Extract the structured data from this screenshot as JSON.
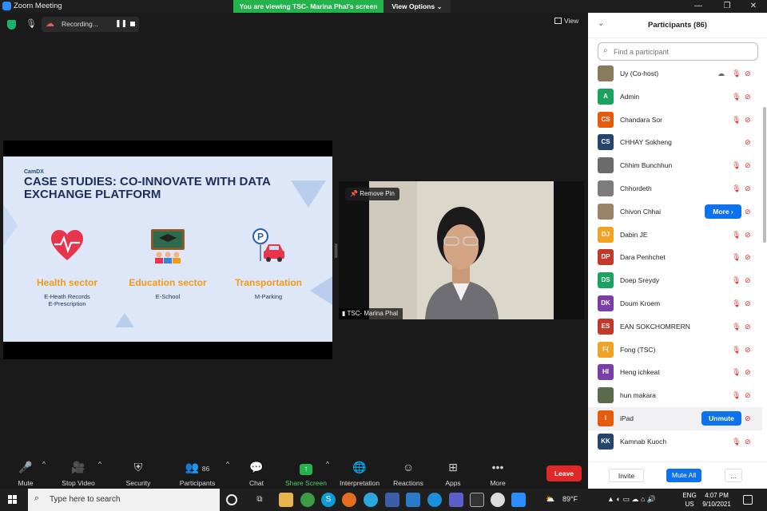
{
  "window": {
    "title": "Zoom Meeting",
    "viewing_banner": "You are viewing TSC- Marina Phal's screen",
    "view_options": "View Options ⌄",
    "minimize": "—",
    "maximize": "❐",
    "close": "✕"
  },
  "meeting": {
    "recording_label": "Recording...",
    "pause": "❚❚",
    "view_label": "View",
    "colors": {
      "secure": "#1ab26b",
      "record": "#e85c5c"
    }
  },
  "slide": {
    "brand": "CamDX",
    "headline": "CASE STUDIES: CO-INNOVATE WITH DATA EXCHANGE PLATFORM",
    "sectors": [
      {
        "name": "Health sector",
        "sub1": "E-Heath Records",
        "sub2": "E-Prescription",
        "icon": "heart-pulse-icon"
      },
      {
        "name": "Education sector",
        "sub1": "E-School",
        "sub2": "",
        "icon": "classroom-icon"
      },
      {
        "name": "Transportation",
        "sub1": "M-Parking",
        "sub2": "",
        "icon": "parking-car-icon"
      }
    ],
    "colors": {
      "background": "#dde7f7",
      "headline": "#1b2f5a",
      "sector": "#f29a1a"
    }
  },
  "video": {
    "remove_pin": "Remove Pin",
    "speaker_name": "TSC- Marina Phal"
  },
  "toolbar": {
    "mute": "Mute",
    "stop_video": "Stop Video",
    "security": "Security",
    "participants": "Participants",
    "participants_count": "86",
    "chat": "Chat",
    "share_screen": "Share Screen",
    "interpretation": "Interpretation",
    "reactions": "Reactions",
    "apps": "Apps",
    "more": "More",
    "leave": "Leave"
  },
  "panel": {
    "title": "Participants (86)",
    "search_placeholder": "Find a participant",
    "more_button": "More ›",
    "unmute_button": "Unmute",
    "invite": "Invite",
    "mute_all": "Mute All",
    "ellipsis": "...",
    "participants": [
      {
        "name": "Uy (Co-host)",
        "initials": "",
        "color": "#8a7a5c",
        "photo": true
      },
      {
        "name": "Admin",
        "initials": "A",
        "color": "#1aa260"
      },
      {
        "name": "Chandara Sor",
        "initials": "CS",
        "color": "#e65a0c"
      },
      {
        "name": "CHHAY Sokheng",
        "initials": "CS",
        "color": "#27456b"
      },
      {
        "name": "Chhim Bunchhun",
        "initials": "",
        "color": "#6b6b6b",
        "photo": true
      },
      {
        "name": "Chhordeth",
        "initials": "",
        "color": "#7c7c7c",
        "photo": true
      },
      {
        "name": "Chivon Chhai",
        "initials": "",
        "color": "#9a8366",
        "photo": true
      },
      {
        "name": "Dabin JE",
        "initials": "DJ",
        "color": "#f0a324"
      },
      {
        "name": "Dara Penhchet",
        "initials": "DP",
        "color": "#c0392b"
      },
      {
        "name": "Doep Sreydy",
        "initials": "DS",
        "color": "#1aa260"
      },
      {
        "name": "Doum Kroem",
        "initials": "DK",
        "color": "#7a3ea8"
      },
      {
        "name": "EAN SOKCHOMRERN",
        "initials": "ES",
        "color": "#c0392b"
      },
      {
        "name": "Fong (TSC)",
        "initials": "F(",
        "color": "#f0a324"
      },
      {
        "name": "Heng ichkeat",
        "initials": "HI",
        "color": "#7a3ea8"
      },
      {
        "name": "hun makara",
        "initials": "",
        "color": "#5c6b4c",
        "photo": true
      },
      {
        "name": "iPad",
        "initials": "I",
        "color": "#e65a0c"
      },
      {
        "name": "Kamnab Kuoch",
        "initials": "KK",
        "color": "#27456b"
      }
    ]
  },
  "taskbar": {
    "search_placeholder": "Type here to search",
    "weather": "89°F",
    "lang_top": "ENG",
    "lang_bottom": "US",
    "time": "4:07 PM",
    "date": "9/10/2021"
  }
}
